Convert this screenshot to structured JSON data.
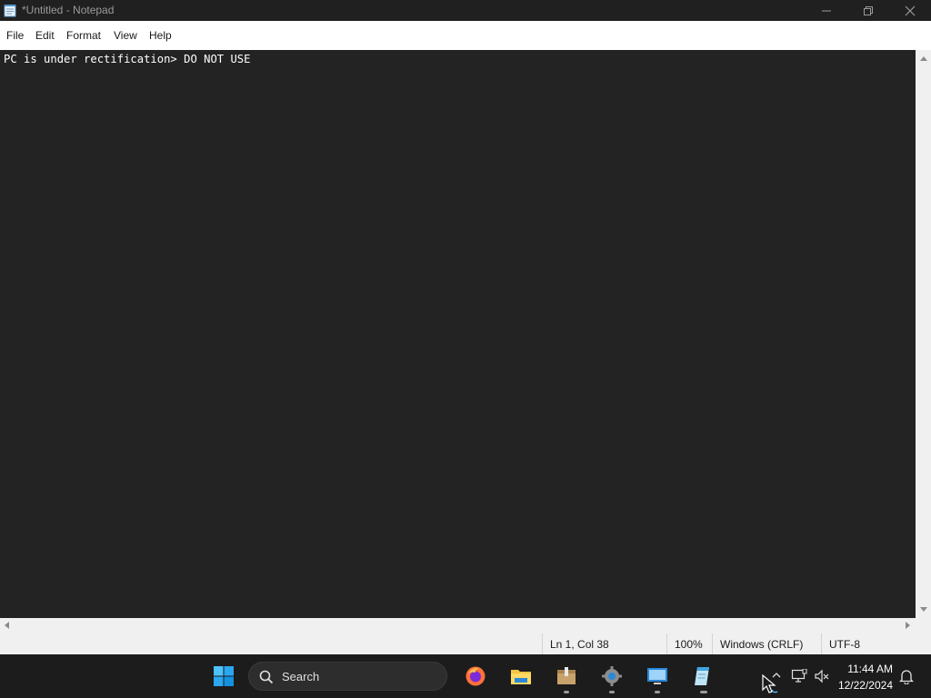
{
  "window": {
    "title": "*Untitled - Notepad",
    "controls": [
      "minimize",
      "restore",
      "close"
    ]
  },
  "menubar": {
    "items": [
      "File",
      "Edit",
      "Format",
      "View",
      "Help"
    ]
  },
  "editor": {
    "content": "PC is under rectification> DO NOT USE",
    "background": "#232323",
    "text_color": "#ffffff"
  },
  "statusbar": {
    "position": "Ln 1, Col 38",
    "zoom": "100%",
    "line_ending": "Windows (CRLF)",
    "encoding": "UTF-8"
  },
  "taskbar": {
    "search_label": "Search",
    "pinned": [
      {
        "icon": "windows-start-icon"
      },
      {
        "icon": "firefox-icon"
      },
      {
        "icon": "file-explorer-icon"
      },
      {
        "icon": "archive-app-icon"
      },
      {
        "icon": "settings-gear-icon"
      },
      {
        "icon": "remote-desktop-icon"
      },
      {
        "icon": "notepad-icon"
      }
    ],
    "tray": {
      "time": "11:44 AM",
      "date": "12/22/2024"
    }
  },
  "colors": {
    "accent": "#0078d4",
    "taskbar": "#1c1c1c",
    "titlebar": "#202020"
  }
}
